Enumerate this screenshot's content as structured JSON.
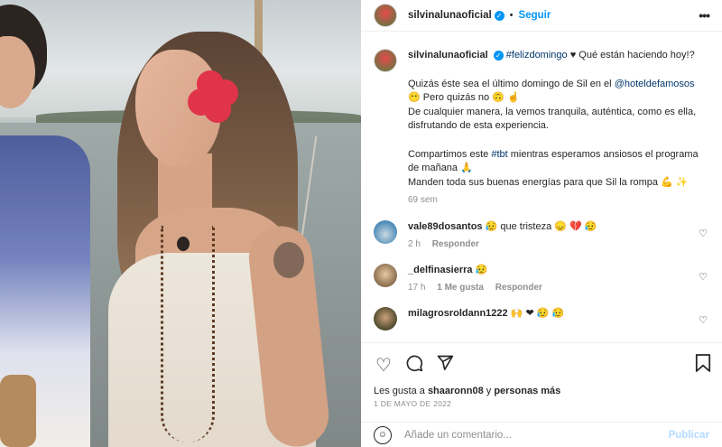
{
  "post": {
    "username": "silvinalunaoficial",
    "follow_label": "Seguir",
    "more": "•••"
  },
  "caption": {
    "username": "silvinalunaoficial",
    "hashtag1": "#felizdomingo",
    "line1_rest": "♥ Qué están haciendo hoy!?",
    "line2_a": "Quizás éste sea el último domingo de Sil en el",
    "mention": "@hoteldefamosos",
    "line2_b": "😶 Pero quizás no 🙃 ☝",
    "line3": "De cualquier manera, la vemos tranquila, auténtica, como es ella, disfrutando de esta experiencia.",
    "line4_a": "Compartimos este",
    "hashtag2": "#tbt",
    "line4_b": "mientras esperamos ansiosos el programa de mañana 🙏",
    "line5": "Manden toda sus buenas energías para que Sil la rompa 💪 ✨",
    "time": "69 sem"
  },
  "comments": [
    {
      "username": "vale89dosantos",
      "text": "😥 que tristeza 😞 💔 😥",
      "time": "2 h",
      "likes": "",
      "reply": "Responder"
    },
    {
      "username": "_delfinasierra",
      "text": "😥",
      "time": "17 h",
      "likes": "1 Me gusta",
      "reply": "Responder"
    },
    {
      "username": "milagrosroldann1222",
      "text": "🙌 ❤ 😥 😥",
      "time": "",
      "likes": "",
      "reply": ""
    }
  ],
  "likes": {
    "prefix": "Les gusta a",
    "user": "shaaronn08",
    "middle": "y",
    "others": "personas más"
  },
  "date": "1 DE MAYO DE 2022",
  "add_comment": {
    "placeholder": "Añade un comentario...",
    "publish": "Publicar"
  },
  "icons": {
    "heart": "heart-icon",
    "comment": "comment-icon",
    "share": "share-icon",
    "save": "bookmark-icon",
    "emoji": "emoji-icon"
  },
  "colors": {
    "accent": "#0095f6",
    "link": "#00376b",
    "muted": "#8e8e8e",
    "flower": "#e0344b"
  }
}
